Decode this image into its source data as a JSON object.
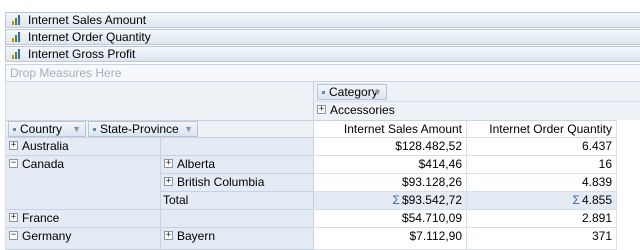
{
  "measures": [
    {
      "label": "Internet Sales Amount"
    },
    {
      "label": "Internet Order Quantity"
    },
    {
      "label": "Internet Gross Profit"
    }
  ],
  "drop_measures": "Drop Measures Here",
  "column_field": {
    "label": "Category"
  },
  "column_member": {
    "label": "Accessories",
    "toggle": "+"
  },
  "row_fields": [
    {
      "label": "Country"
    },
    {
      "label": "State-Province"
    }
  ],
  "value_headers": [
    "Internet Sales Amount",
    "Internet Order Quantity"
  ],
  "rows": [
    {
      "country": "Australia",
      "ctoggle": "+",
      "state": "",
      "stoggle": "",
      "sales": "$128.482,52",
      "qty": "6.437"
    },
    {
      "country": "Canada",
      "ctoggle": "−",
      "state": "Alberta",
      "stoggle": "+",
      "sales": "$414,46",
      "qty": "16"
    },
    {
      "country": "",
      "ctoggle": "",
      "state": "British Columbia",
      "stoggle": "+",
      "sales": "$93.128,26",
      "qty": "4.839"
    },
    {
      "country": "",
      "ctoggle": "",
      "state": "Total",
      "stoggle": "",
      "sales": "$93.542,72",
      "qty": "4.855",
      "total": true
    },
    {
      "country": "France",
      "ctoggle": "+",
      "state": "",
      "stoggle": "",
      "sales": "$54.710,09",
      "qty": "2.891"
    },
    {
      "country": "Germany",
      "ctoggle": "−",
      "state": "Bayern",
      "stoggle": "+",
      "sales": "$7.112,90",
      "qty": "371"
    }
  ],
  "sigma": "Σ",
  "icons": {
    "measure": "bar-chart-icon",
    "sort": "chevron-down-icon"
  }
}
